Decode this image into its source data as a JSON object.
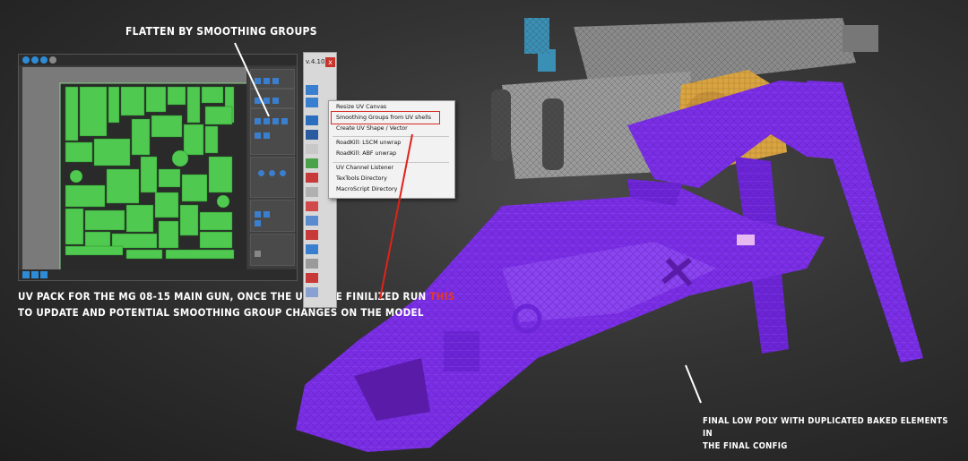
{
  "captions": {
    "flatten_title": "FLATTEN BY SMOOTHING GROUPS",
    "uv_pack_line1": "UV PACK FOR THE MG 08-15 MAIN GUN, ONCE THE UVS ARE FINILIZED RUN",
    "uv_pack_highlight": "THIS",
    "uv_pack_line2": "TO UPDATE AND POTENTIAL SMOOTHING GROUP CHANGES ON THE MODEL",
    "final_line1": "FINAL LOW POLY WITH DUPLICATED BAKED ELEMENTS IN",
    "final_line2": "THE FINAL CONFIG"
  },
  "textools": {
    "version": "v.4.10",
    "close_label": "x"
  },
  "context_menu": {
    "items": [
      "Resize UV Canvas",
      "Smoothing Groups from UV shells",
      "Create UV Shape / Vector",
      "RoadKill: LSCM unwrap",
      "RoadKill: ABF unwrap",
      "UV Channel Listener",
      "TexTools Directory",
      "MacroScript Directory"
    ],
    "highlighted_item": "Smoothing Groups from UV shells"
  },
  "colors": {
    "highlight_red": "#e23a2a",
    "uv_green": "#4fc94f",
    "model_purple": "#7a2ee6",
    "model_gold": "#d9a441",
    "model_grey": "#8a8a8a",
    "model_blue": "#3a8fb5"
  }
}
